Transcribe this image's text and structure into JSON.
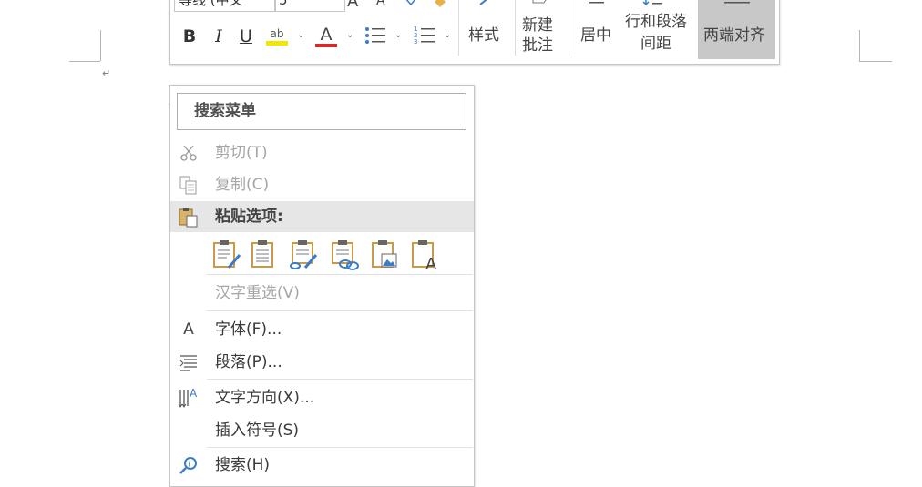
{
  "document": {
    "paragraph_mark": "↵"
  },
  "mini_toolbar": {
    "font_name": "等线 (中文",
    "font_size": "5",
    "grow_font_glyph": "A",
    "shrink_font_glyph": "A",
    "bold": "B",
    "italic": "I",
    "underline": "U",
    "highlight_letters": "ab",
    "font_color_letter": "A",
    "colors": {
      "highlight": "#f5e600",
      "font_color": "#d32b2b",
      "active_bg": "#c8c8c8"
    },
    "styles_label": "样式",
    "new_comment_label_1": "新建",
    "new_comment_label_2": "批注",
    "center_label": "居中",
    "line_spacing_label_1": "行和段落",
    "line_spacing_label_2": "间距",
    "justify_label": "两端对齐"
  },
  "context_menu": {
    "search_placeholder": "搜索菜单",
    "cut": "剪切(T)",
    "copy": "复制(C)",
    "paste_options_header": "粘贴选项:",
    "paste_options": [
      "keep-source-formatting",
      "merge-formatting",
      "use-destination-styles",
      "link-and-keep-formatting",
      "picture",
      "keep-text-only"
    ],
    "reconversion": "汉字重选(V)",
    "font": "字体(F)...",
    "paragraph": "段落(P)...",
    "text_direction": "文字方向(X)...",
    "insert_symbol": "插入符号(S)",
    "search": "搜索(H)"
  }
}
